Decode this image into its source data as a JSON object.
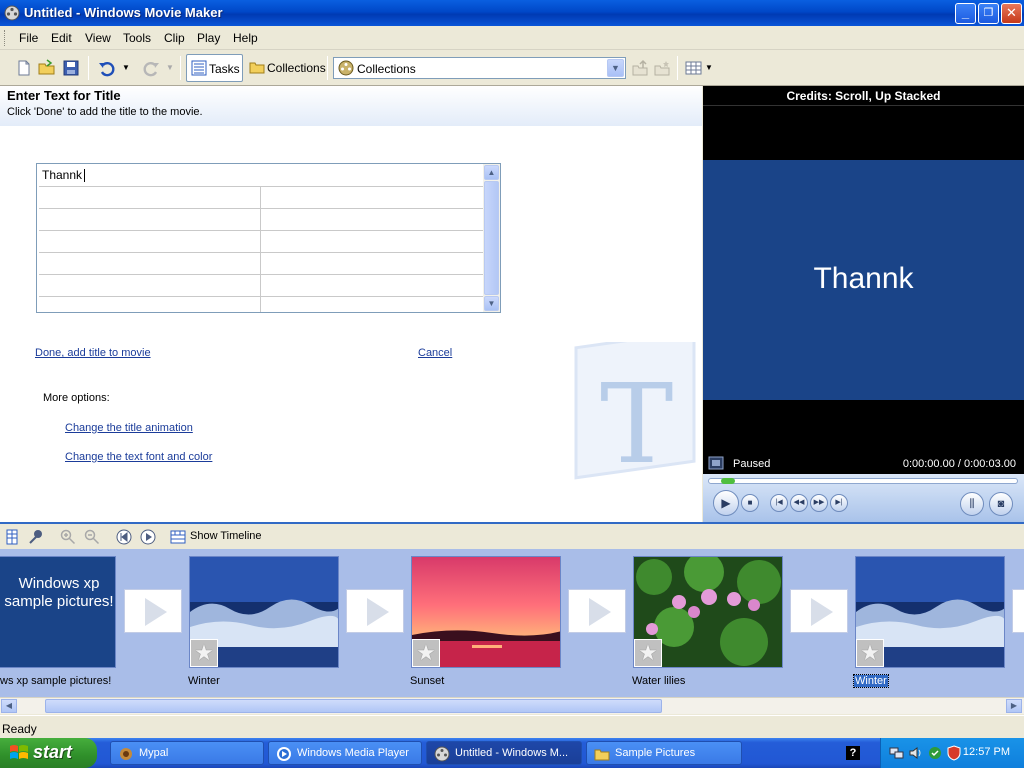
{
  "window": {
    "title": "Untitled - Windows Movie Maker",
    "min": "_",
    "max": "❐",
    "close": "✕"
  },
  "menu": [
    "File",
    "Edit",
    "View",
    "Tools",
    "Clip",
    "Play",
    "Help"
  ],
  "toolbar": {
    "tasks_label": "Tasks",
    "collections_label": "Collections",
    "combo_value": "Collections"
  },
  "task_pane": {
    "heading": "Enter Text for Title",
    "instruction": "Click 'Done' to add the title to the movie.",
    "typed_text": "Thannk",
    "done_link": "Done, add title to movie",
    "cancel_link": "Cancel",
    "more_options": "More options:",
    "animation_link": "Change the title animation",
    "font_link": "Change the text font and color"
  },
  "preview": {
    "caption": "Credits: Scroll, Up Stacked",
    "screen_text": "Thannk",
    "state": "Paused",
    "time": "0:00:00.00 / 0:00:03.00",
    "progress": 0.04
  },
  "storyboard_toolbar": {
    "show_timeline": "Show Timeline"
  },
  "storyboard": {
    "title_clip_text": "Windows xp sample pictures!",
    "clips": [
      {
        "label": "ws xp sample pictures!",
        "kind": "title"
      },
      {
        "label": "Winter",
        "kind": "winter"
      },
      {
        "label": "Sunset",
        "kind": "sunset"
      },
      {
        "label": "Water lilies",
        "kind": "lilies"
      },
      {
        "label": "Winter",
        "kind": "winter",
        "selected": true
      }
    ]
  },
  "status": "Ready",
  "taskbar": {
    "start": "start",
    "items": [
      {
        "label": "Mypal"
      },
      {
        "label": "Windows Media Player"
      },
      {
        "label": "Untitled - Windows M...",
        "active": true
      },
      {
        "label": "Sample Pictures"
      }
    ],
    "clock": "12:57 PM",
    "help": "?"
  },
  "colors": {
    "titlebar": "#0a5fe0",
    "preview_screen": "#1a4488",
    "storyboard_bg": "#a9bde8",
    "link": "#1b3c9a"
  }
}
